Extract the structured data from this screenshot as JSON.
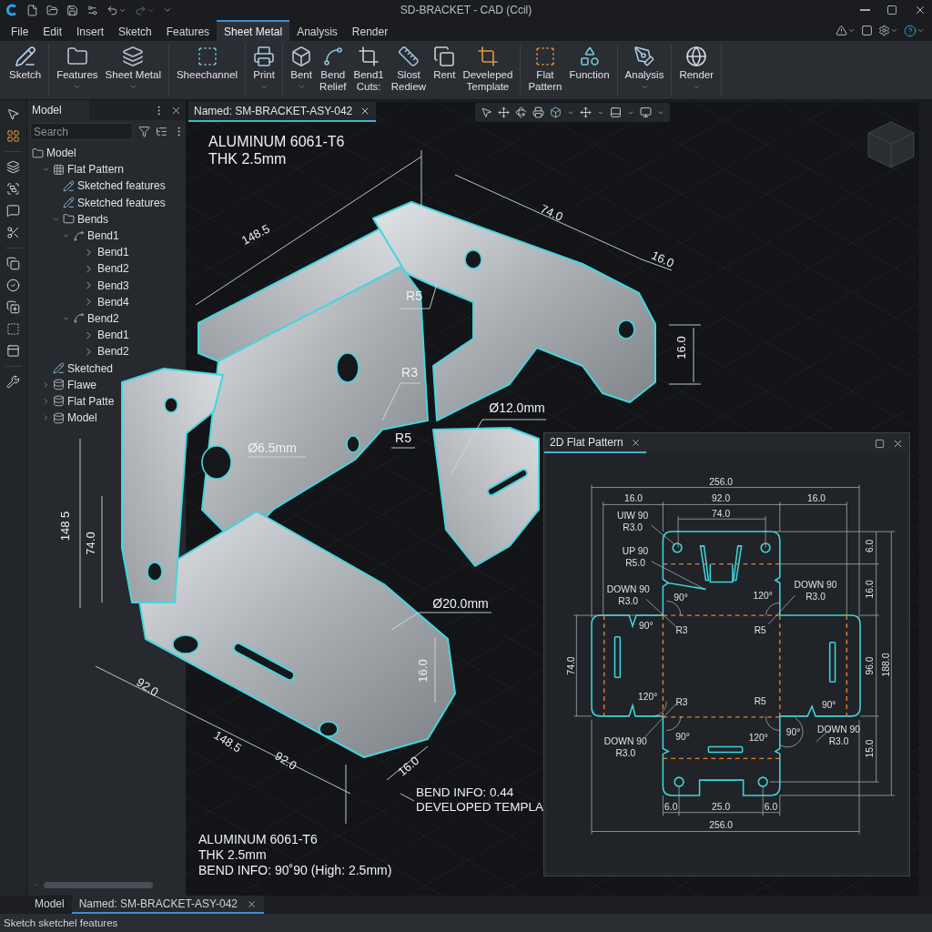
{
  "title_bar": {
    "title": "SD-BRACKET - CAD (Ccil)"
  },
  "menu": [
    {
      "label": "File",
      "selected": false
    },
    {
      "label": "Edit",
      "selected": false
    },
    {
      "label": "Insert",
      "selected": false
    },
    {
      "label": "Sketch",
      "selected": false
    },
    {
      "label": "Features",
      "selected": false
    },
    {
      "label": "Sheet Metal",
      "selected": true
    },
    {
      "label": "Analysis",
      "selected": false
    },
    {
      "label": "Render",
      "selected": false
    }
  ],
  "ribbon": {
    "groups": [
      [
        {
          "label": "Sketch",
          "dropdown": false
        }
      ],
      [
        {
          "label": "Features",
          "dropdown": true
        },
        {
          "label": "Sheet Metal",
          "dropdown": true
        }
      ],
      [
        {
          "label": "Sheechannel",
          "dropdown": false
        }
      ],
      [
        {
          "label": "Print",
          "dropdown": true
        }
      ],
      [
        {
          "label": "Bent",
          "dropdown": true
        },
        {
          "label": "Bend\nRelief",
          "dropdown": false
        },
        {
          "label": "Bend1\nCuts:",
          "dropdown": false
        },
        {
          "label": "Slost\nRediew",
          "dropdown": false
        },
        {
          "label": "Rent",
          "dropdown": false
        },
        {
          "label": "Develeped\nTemplate",
          "dropdown": false
        }
      ],
      [
        {
          "label": "Flat\nPattern",
          "dropdown": false
        },
        {
          "label": "Function",
          "dropdown": false
        }
      ],
      [
        {
          "label": "Analysis",
          "dropdown": true
        }
      ],
      [
        {
          "label": "Render",
          "dropdown": true
        }
      ]
    ]
  },
  "model_panel": {
    "title": "Model",
    "search": {
      "placeholder": "Search"
    },
    "tree": [
      {
        "label": "Model",
        "kind": "folder",
        "children": [
          {
            "label": "Flat Pattern",
            "kind": "grid",
            "expanded": true,
            "children": [
              {
                "label": "Sketched features",
                "kind": "sketch"
              },
              {
                "label": "Sketched features",
                "kind": "sketch"
              },
              {
                "label": "Bends",
                "kind": "folder",
                "expanded": true,
                "children": [
                  {
                    "label": "Bend1",
                    "kind": "bend-group",
                    "expanded": true,
                    "children": [
                      {
                        "label": "Bend1",
                        "kind": "bend"
                      },
                      {
                        "label": "Bend2",
                        "kind": "bend"
                      },
                      {
                        "label": "Bend3",
                        "kind": "bend"
                      },
                      {
                        "label": "Bend4",
                        "kind": "bend"
                      }
                    ]
                  },
                  {
                    "label": "Bend2",
                    "kind": "bend-group",
                    "expanded": true,
                    "children": [
                      {
                        "label": "Bend1",
                        "kind": "bend"
                      },
                      {
                        "label": "Bend2",
                        "kind": "bend"
                      }
                    ]
                  }
                ]
              }
            ]
          },
          {
            "label": "Sketched",
            "kind": "sketch"
          },
          {
            "label": "Flawe",
            "kind": "stack",
            "expanded": false
          },
          {
            "label": "Flat Patte",
            "kind": "stack",
            "expanded": false
          },
          {
            "label": "Model",
            "kind": "stack",
            "expanded": false
          }
        ]
      }
    ]
  },
  "viewport": {
    "tab": {
      "label": "Named: SM-BRACKET-ASY-042",
      "selected": true
    },
    "annotations": [
      "ALUMINUM 6061-T6\nTHK 2.5mm",
      "148.5",
      "74.0",
      "16.0",
      "R5",
      "16.0",
      "R3",
      "Ø12.0mm",
      "Ø6.5mm",
      "R5",
      "148 5",
      "74.0",
      "Ø20.0mm",
      "16.0",
      "92.0",
      "148.5",
      "92.0",
      "16.0",
      "BEND INFO: 0.44\nDEVELOPED TEMPLA",
      "ALUMINUM 6061-T6\nTHK 2.5mm\nBEND INFO: 90˚90 (High: 2.5mm)"
    ]
  },
  "flat_pattern": {
    "title": "2D Flat Pattern",
    "labels": [
      "256.0",
      "16.0",
      "92.0",
      "16.0",
      "74.0",
      "UIW 90\nR3.0",
      "UP 90\nR5.0",
      "DOWN 90\nR3.0",
      "90°",
      "120°",
      "DOWN 90\nR3.0",
      "90°",
      "R3",
      "R5",
      "74.0",
      "96.0",
      "188.0",
      "6.0",
      "16.0",
      "15.0",
      "120°",
      "R3",
      "R5",
      "90°",
      "DOWN 90\nR3.0",
      "90°",
      "120°",
      "90°",
      "DOWN 90\nR3.0",
      "6.0",
      "25.0",
      "6.0",
      "256.0"
    ]
  },
  "bottom_tabs": [
    {
      "label": "Model",
      "selected": false
    },
    {
      "label": "Named: SM-BRACKET-ASY-042",
      "selected": true
    }
  ],
  "status_bar": {
    "text": "Sketch sketchel features"
  }
}
